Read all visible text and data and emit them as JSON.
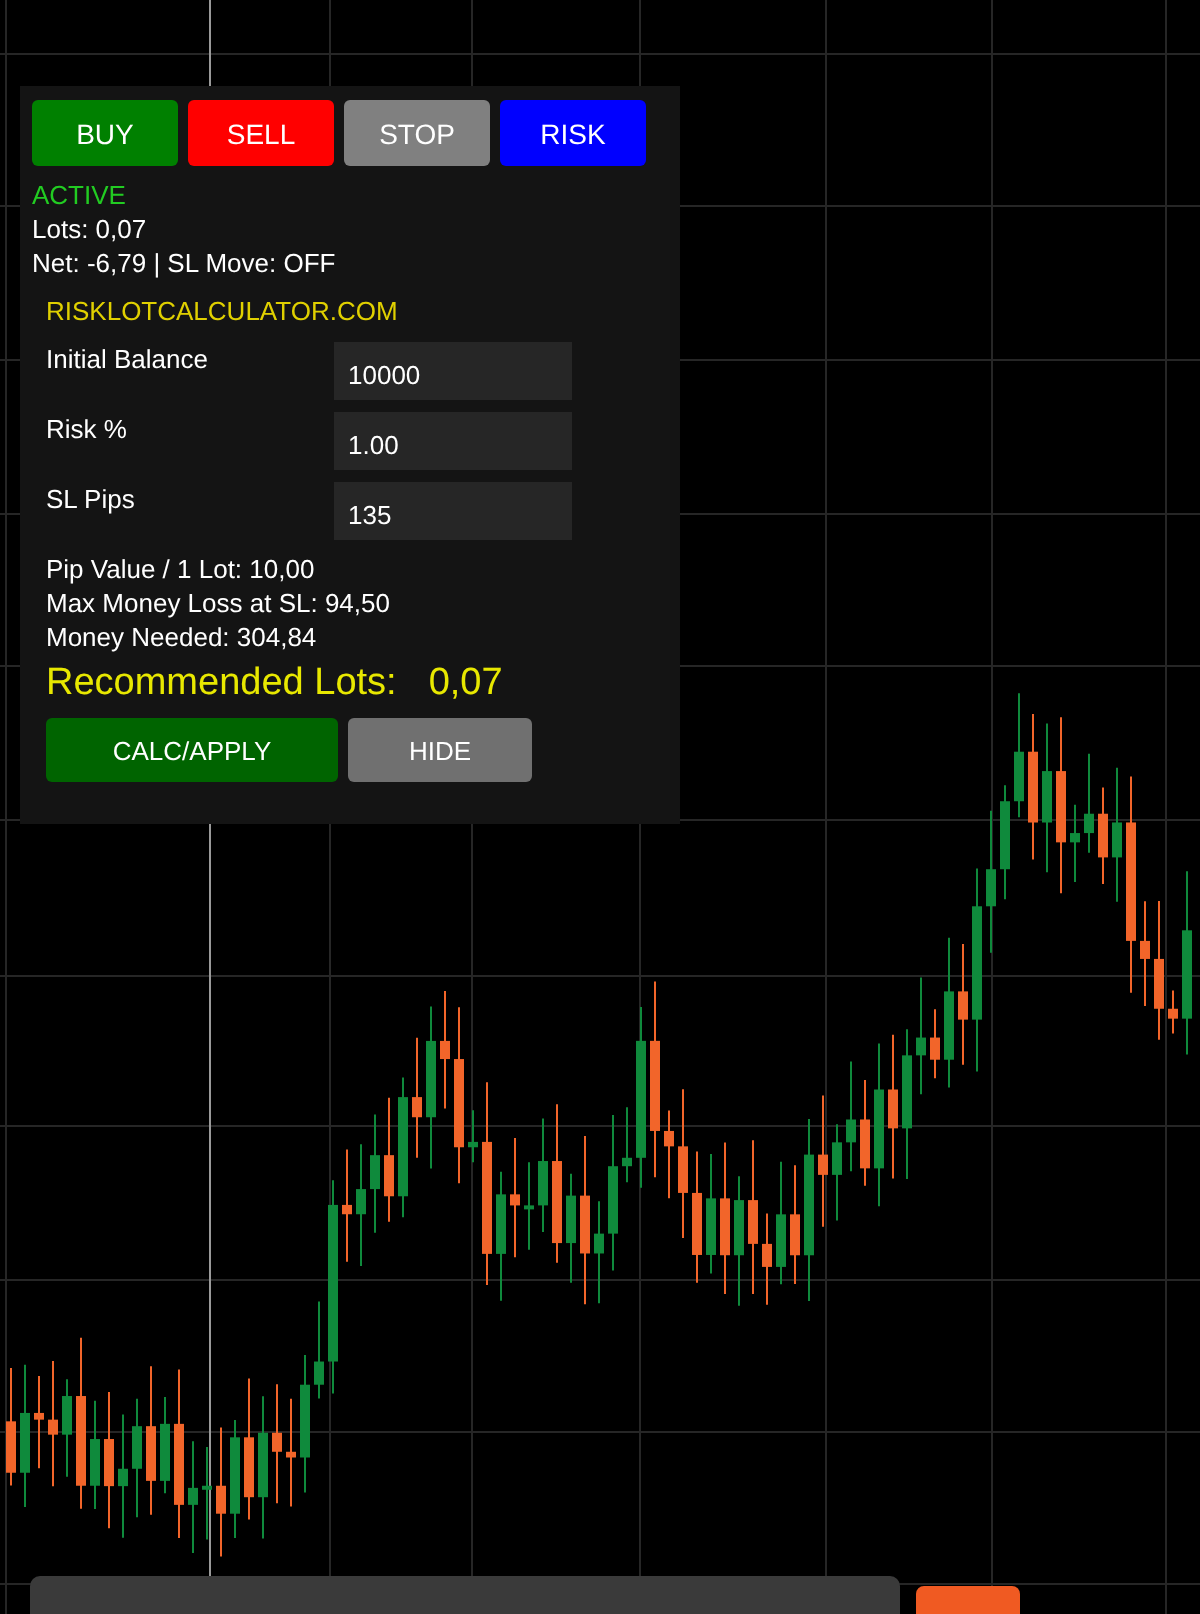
{
  "trade_buttons": [
    {
      "label": "BUY",
      "color": "#008000"
    },
    {
      "label": "SELL",
      "color": "#ff0000"
    },
    {
      "label": "STOP",
      "color": "#808080"
    },
    {
      "label": "RISK",
      "color": "#0000ff"
    }
  ],
  "status": "ACTIVE",
  "lots": "Lots: 0,07",
  "net_line": "Net: -6,79 | SL Move: OFF",
  "calculator": {
    "title": "RISKLOTCALCULATOR.COM",
    "fields": [
      {
        "label": "Initial Balance",
        "value": "10000"
      },
      {
        "label": "Risk %",
        "value": "1.00"
      },
      {
        "label": "SL Pips",
        "value": "135"
      }
    ],
    "results": [
      "Pip Value / 1 Lot: 10,00",
      "Max Money Loss at SL: 94,50",
      "Money Needed: 304,84"
    ],
    "recommended_label": "Recommended Lots:",
    "recommended_value": "0,07",
    "buttons": [
      {
        "label": "CALC/APPLY",
        "color": "#006400"
      },
      {
        "label": "HIDE",
        "color": "#707070"
      }
    ]
  }
}
